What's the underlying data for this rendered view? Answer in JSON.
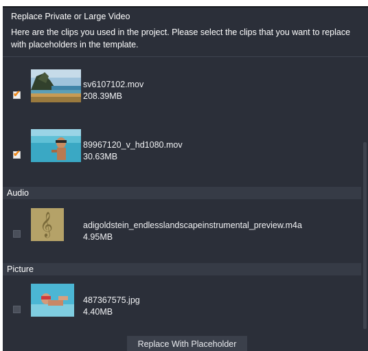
{
  "dialog": {
    "title": "Replace Private or Large Video",
    "instruction": "Here are the clips you used in the project. Please select the clips that you want to replace with placeholders in the template."
  },
  "clips": [
    {
      "name": "sv6107102.mov",
      "size": "208.39MB",
      "checked": true,
      "thumbnail": "beach-coast-thumbnail"
    },
    {
      "name": "89967120_v_hd1080.mov",
      "size": "30.63MB",
      "checked": true,
      "thumbnail": "snorkel-selfie-thumbnail"
    }
  ],
  "audio": {
    "header": "Audio",
    "items": [
      {
        "name": "adigoldstein_endlesslandscapeinstrumental_preview.m4a",
        "size": "4.95MB",
        "checked": false,
        "thumbnail": "treble-clef-icon",
        "glyph": "𝄞"
      }
    ]
  },
  "picture": {
    "header": "Picture",
    "items": [
      {
        "name": "487367575.jpg",
        "size": "4.40MB",
        "checked": false,
        "thumbnail": "underwater-diver-thumbnail"
      }
    ]
  },
  "footer": {
    "button_label": "Replace With Placeholder"
  },
  "colors": {
    "background": "#2b2f39",
    "section_header": "#363b46",
    "checkbox_tick": "#f08a1c",
    "button": "#3b404b"
  },
  "icons": {
    "checkbox_tick": "✔"
  }
}
